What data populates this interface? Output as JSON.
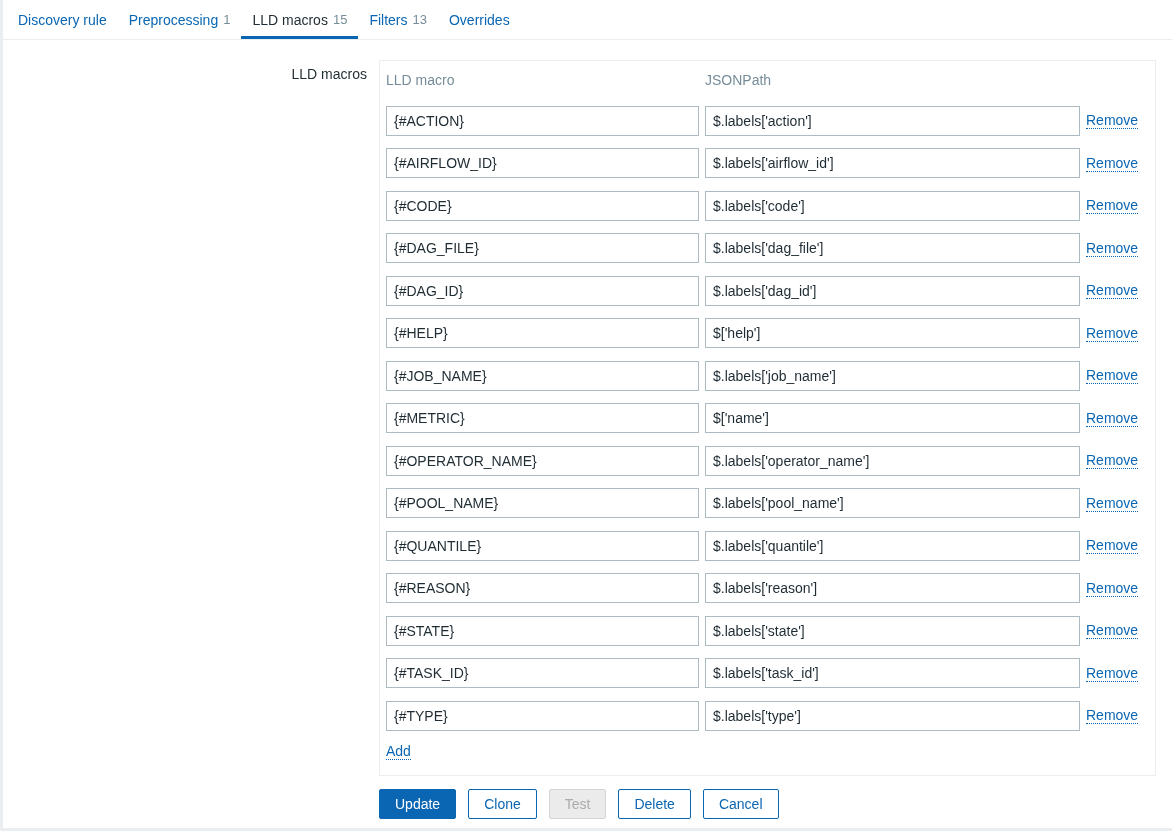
{
  "tabs": [
    {
      "label": "Discovery rule",
      "selected": false
    },
    {
      "label": "Preprocessing",
      "count": "1",
      "selected": false
    },
    {
      "label": "LLD macros",
      "count": "15",
      "selected": true
    },
    {
      "label": "Filters",
      "count": "13",
      "selected": false
    },
    {
      "label": "Overrides",
      "selected": false
    }
  ],
  "form": {
    "label": "LLD macros",
    "columns": [
      "LLD macro",
      "JSONPath"
    ],
    "rows": [
      {
        "macro": "{#ACTION}",
        "path": "$.labels['action']",
        "action": "Remove"
      },
      {
        "macro": "{#AIRFLOW_ID}",
        "path": "$.labels['airflow_id']",
        "action": "Remove"
      },
      {
        "macro": "{#CODE}",
        "path": "$.labels['code']",
        "action": "Remove"
      },
      {
        "macro": "{#DAG_FILE}",
        "path": "$.labels['dag_file']",
        "action": "Remove"
      },
      {
        "macro": "{#DAG_ID}",
        "path": "$.labels['dag_id']",
        "action": "Remove"
      },
      {
        "macro": "{#HELP}",
        "path": "$['help']",
        "action": "Remove"
      },
      {
        "macro": "{#JOB_NAME}",
        "path": "$.labels['job_name']",
        "action": "Remove"
      },
      {
        "macro": "{#METRIC}",
        "path": "$['name']",
        "action": "Remove"
      },
      {
        "macro": "{#OPERATOR_NAME}",
        "path": "$.labels['operator_name']",
        "action": "Remove"
      },
      {
        "macro": "{#POOL_NAME}",
        "path": "$.labels['pool_name']",
        "action": "Remove"
      },
      {
        "macro": "{#QUANTILE}",
        "path": "$.labels['quantile']",
        "action": "Remove"
      },
      {
        "macro": "{#REASON}",
        "path": "$.labels['reason']",
        "action": "Remove"
      },
      {
        "macro": "{#STATE}",
        "path": "$.labels['state']",
        "action": "Remove"
      },
      {
        "macro": "{#TASK_ID}",
        "path": "$.labels['task_id']",
        "action": "Remove"
      },
      {
        "macro": "{#TYPE}",
        "path": "$.labels['type']",
        "action": "Remove"
      }
    ],
    "add": "Add"
  },
  "buttons": [
    {
      "label": "Update",
      "kind": "primary",
      "disabled": false
    },
    {
      "label": "Clone",
      "kind": "secondary",
      "disabled": false
    },
    {
      "label": "Test",
      "kind": "secondary",
      "disabled": true
    },
    {
      "label": "Delete",
      "kind": "secondary",
      "disabled": false
    },
    {
      "label": "Cancel",
      "kind": "secondary",
      "disabled": false
    }
  ]
}
